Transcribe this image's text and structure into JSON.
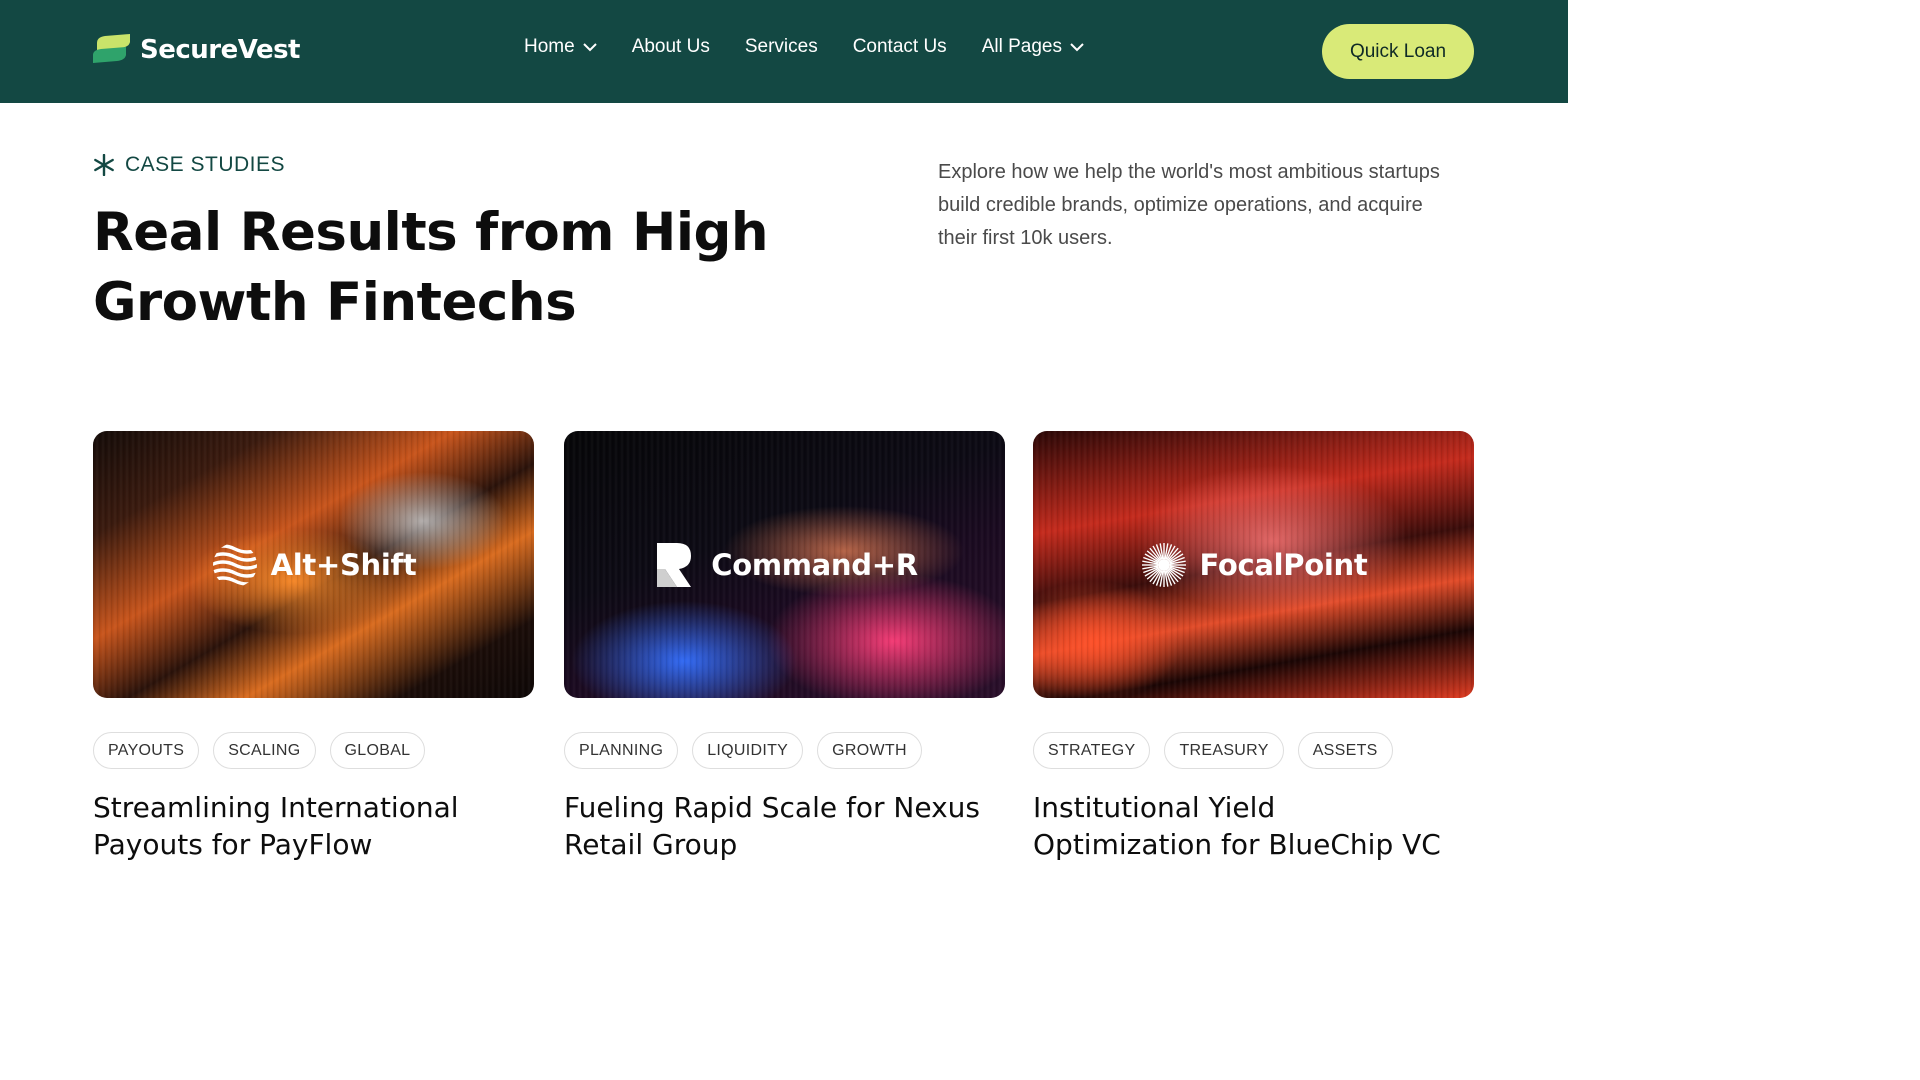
{
  "header": {
    "brand": "SecureVest",
    "nav": [
      {
        "label": "Home",
        "has_dropdown": true
      },
      {
        "label": "About Us",
        "has_dropdown": false
      },
      {
        "label": "Services",
        "has_dropdown": false
      },
      {
        "label": "Contact Us",
        "has_dropdown": false
      },
      {
        "label": "All Pages",
        "has_dropdown": true
      }
    ],
    "cta_label": "Quick Loan"
  },
  "hero": {
    "eyebrow": "CASE STUDIES",
    "title": "Real Results from High Growth Fintechs",
    "description": "Explore how we help the world's most ambitious startups build credible brands, optimize operations, and acquire their first 10k users."
  },
  "cards": [
    {
      "logo_name": "Alt+Shift",
      "logo_icon": "waves-globe-icon",
      "tags": [
        "PAYOUTS",
        "SCALING",
        "GLOBAL"
      ],
      "title": "Streamlining International Payouts for PayFlow"
    },
    {
      "logo_name": "Command+R",
      "logo_icon": "r-letter-icon",
      "tags": [
        "PLANNING",
        "LIQUIDITY",
        "GROWTH"
      ],
      "title": "Fueling Rapid Scale for Nexus Retail Group"
    },
    {
      "logo_name": "FocalPoint",
      "logo_icon": "starburst-icon",
      "tags": [
        "STRATEGY",
        "TREASURY",
        "ASSETS"
      ],
      "title": "Institutional Yield Optimization for BlueChip VC"
    }
  ],
  "colors": {
    "header_bg": "#134843",
    "cta_bg": "#d9ea78",
    "accent_text": "#134843"
  }
}
